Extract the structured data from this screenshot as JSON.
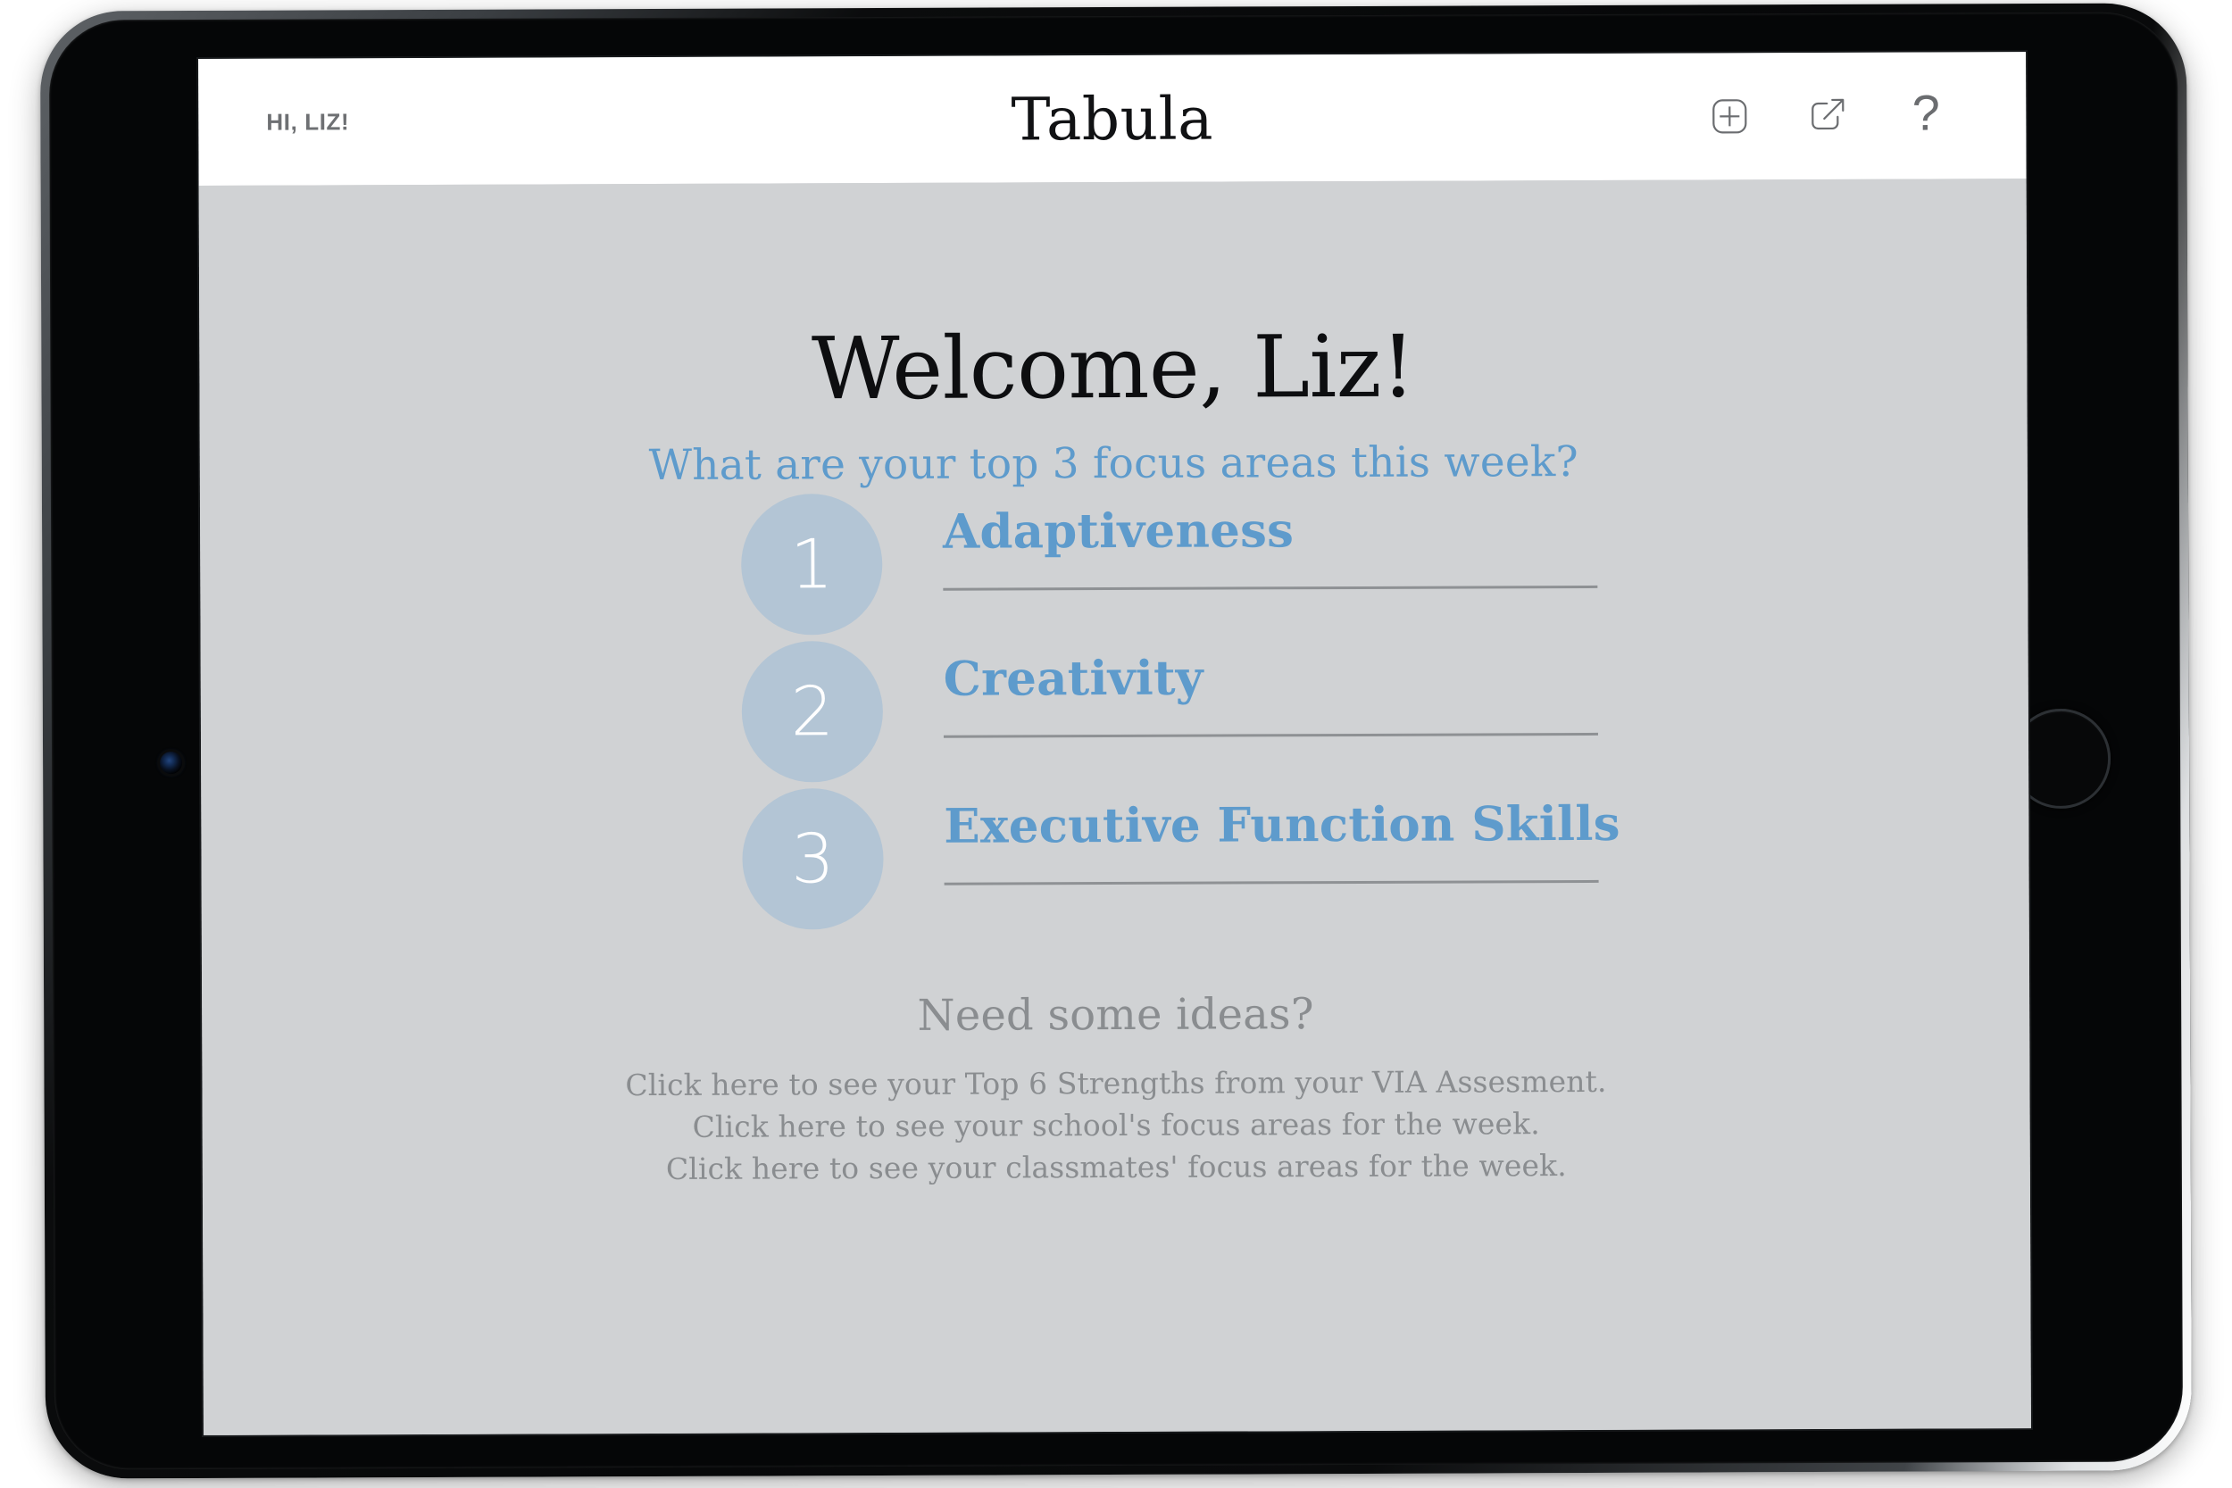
{
  "app": {
    "title": "Tabula",
    "greeting": "HI, LIZ!"
  },
  "header": {
    "icons": [
      {
        "name": "add-icon",
        "label": "Add"
      },
      {
        "name": "share-icon",
        "label": "Share"
      },
      {
        "name": "help-icon",
        "label": "?"
      }
    ]
  },
  "main": {
    "welcome_heading": "Welcome, Liz!",
    "subtitle": "What are your top 3 focus areas this week?",
    "focus_areas": [
      {
        "number": "1",
        "value": "Adaptiveness"
      },
      {
        "number": "2",
        "value": "Creativity"
      },
      {
        "number": "3",
        "value": "Executive Function Skills"
      }
    ]
  },
  "ideas": {
    "title": "Need some ideas?",
    "links": [
      "Click here to see your Top 6 Strengths from your VIA Assesment.",
      "Click here to see your school's focus areas for the week.",
      "Click here to see your classmates' focus areas for the week."
    ]
  },
  "colors": {
    "accent_blue": "#5e9bcc",
    "badge_blue": "#b3c5d5",
    "screen_bg": "#d0d2d4",
    "muted_gray": "#8a8d90"
  }
}
